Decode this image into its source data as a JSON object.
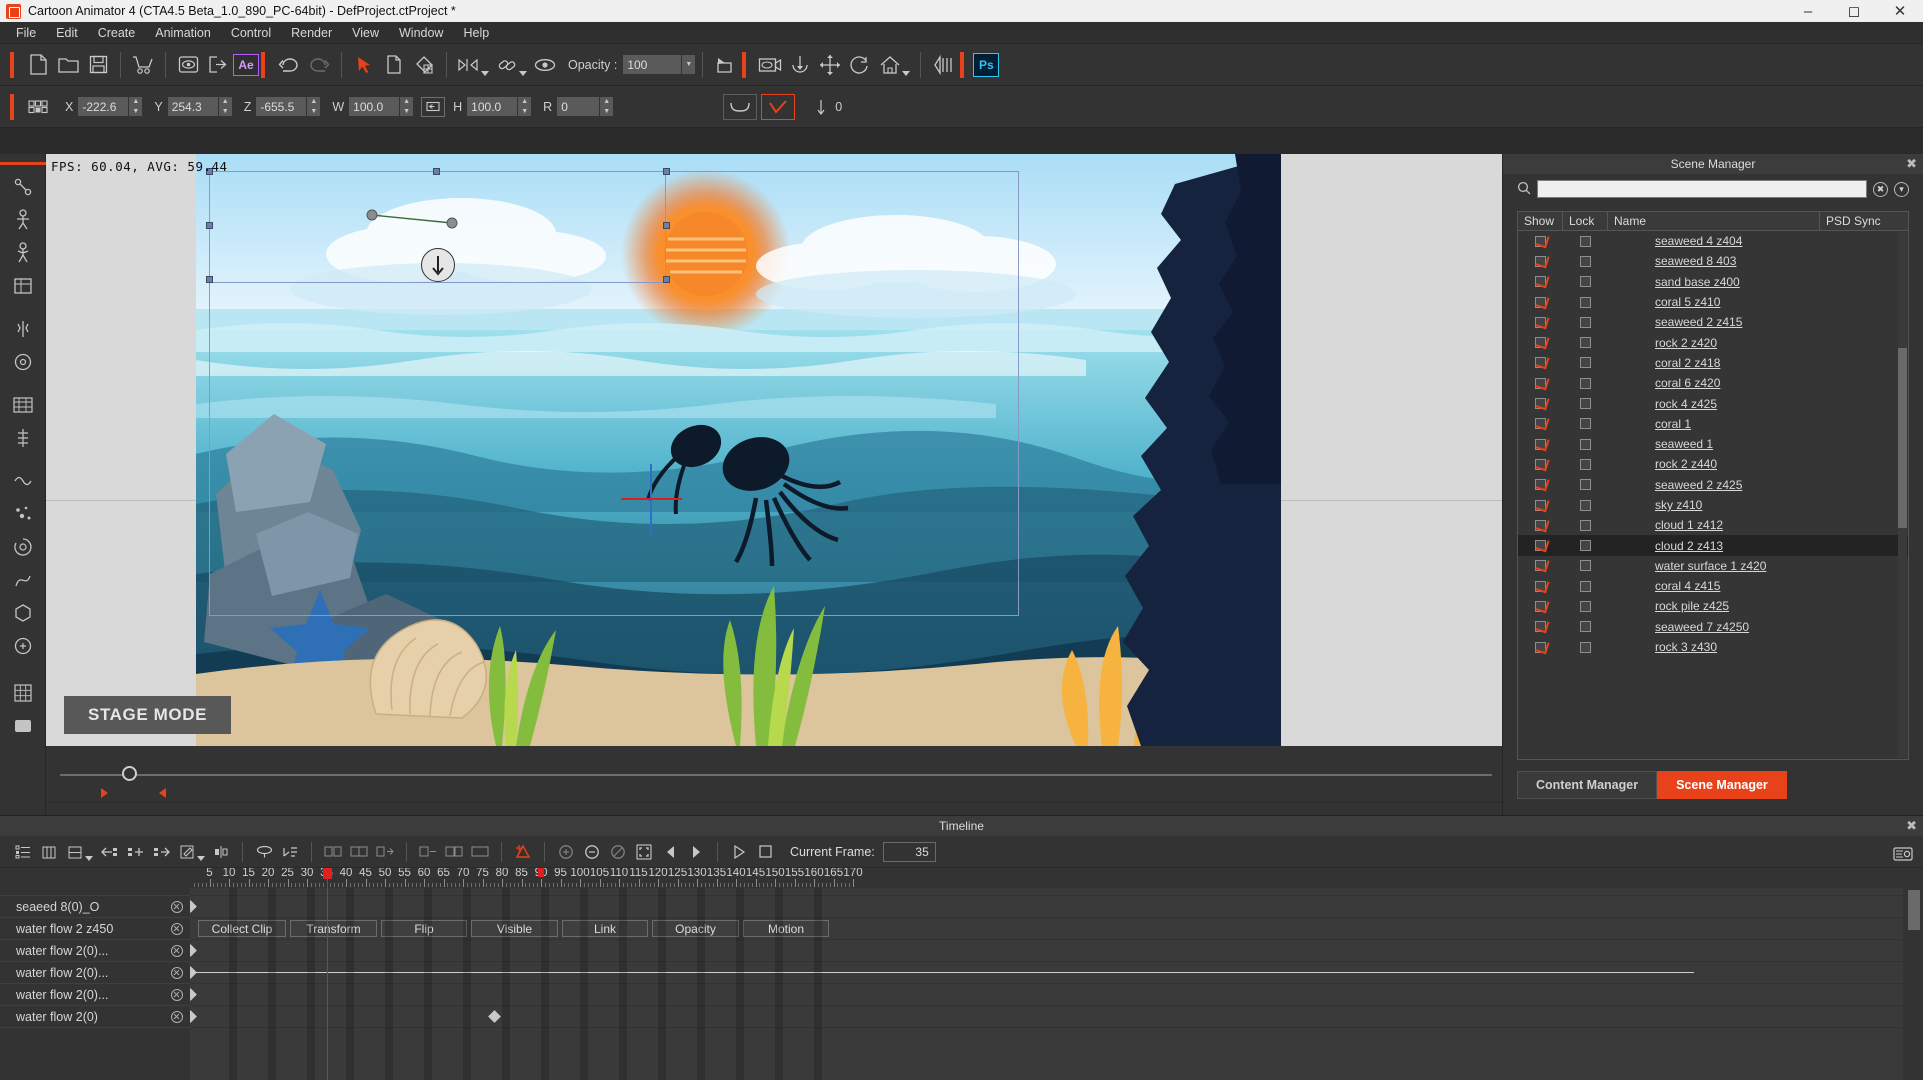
{
  "window": {
    "title": "Cartoon Animator 4  (CTA4.5 Beta_1.0_890_PC-64bit) - DefProject.ctProject *",
    "logo_icon": "cartoon-animator-logo",
    "minimize": "–",
    "maximize": "☐",
    "close": "✕"
  },
  "menu": {
    "items": [
      "File",
      "Edit",
      "Create",
      "Animation",
      "Control",
      "Render",
      "View",
      "Window",
      "Help"
    ]
  },
  "toolbar_main": {
    "icons": [
      "new-project-icon",
      "open-project-icon",
      "save-project-icon",
      "store-cart-icon",
      "preview-icon",
      "export-icon",
      "after-effects-icon",
      "undo-icon",
      "redo-icon",
      "select-arrow-icon",
      "duplicate-icon",
      "fill-color-icon",
      "align-icon",
      "link-icon",
      "eye-visible-icon",
      "flip-icon",
      "camera-icon",
      "pivot-icon",
      "move-icon",
      "rotate-icon",
      "home-view-icon",
      "onion-skin-icon",
      "photoshop-icon"
    ],
    "opacity_label": "Opacity :",
    "opacity_value": "100",
    "ae_badge": "Ae",
    "ps_badge": "Ps"
  },
  "transform_bar": {
    "grid_icon": "transform-pivot-grid-icon",
    "fields": [
      {
        "axis": "X",
        "value": "-222.6"
      },
      {
        "axis": "Y",
        "value": "254.3"
      },
      {
        "axis": "Z",
        "value": "-655.5"
      },
      {
        "axis": "W",
        "value": "100.0"
      },
      {
        "axis": "H",
        "value": "100.0"
      },
      {
        "axis": "R",
        "value": "0"
      }
    ],
    "lock_aspect_icon": "lock-aspect-ratio-icon",
    "smooth_icon": "curve-smooth-icon",
    "check_icon": "check-mark-icon",
    "z_label": "0",
    "z_icon": "z-depth-icon"
  },
  "left_tools": {
    "icons": [
      "bone-editor-icon",
      "character-icon",
      "puppet-icon",
      "sprite-editor-icon",
      "face-icon",
      "head-icon",
      "motion-icon",
      "spring-icon",
      "elastic-icon",
      "particle-icon",
      "camera-tool-icon",
      "path-icon",
      "prop-icon",
      "sfx-icon",
      "grid-tool-icon",
      "render-tool-icon"
    ]
  },
  "viewport": {
    "fps_text": "FPS: 60.04, AVG: 59.44",
    "stage_mode": "STAGE MODE",
    "scene": {
      "sun": "sun-graphic",
      "sky": "sky-gradient",
      "water": "underwater-scene",
      "colors": {
        "sky_top": "#9ed6f5",
        "sky_bottom": "#d9eefb",
        "water_top": "#8fd8e8",
        "water_mid": "#3fa0bd",
        "water_deep": "#1d5f7d",
        "sun": "#f57c20",
        "sand": "#e0c6a0",
        "rock_cliff": "#16233f"
      }
    }
  },
  "time_slider": {
    "position_percent": 2,
    "marker_left_icon": "range-start-marker",
    "marker_right_icon": "range-end-marker"
  },
  "transport": {
    "left_slider_icon": "speech-bubble-icon",
    "buttons": [
      "play-icon",
      "stop-icon",
      "first-frame-icon",
      "prev-frame-icon",
      "next-frame-icon",
      "last-frame-icon",
      "loop-icon"
    ],
    "frame_value": "35",
    "settings_icon": "render-settings-icon",
    "list_icon": "frame-list-icon",
    "note_icon": "music-note-icon"
  },
  "scene_manager": {
    "title": "Scene Manager",
    "close_icon": "close-icon",
    "search_icon": "search-icon",
    "clear_icon": "clear-search-icon",
    "filter_icon": "filter-dropdown-icon",
    "search_value": "",
    "columns": [
      "Show",
      "Lock",
      "Name",
      "PSD Sync"
    ],
    "rows": [
      {
        "show": true,
        "lock": false,
        "name": "seaweed 4 z404",
        "selected": false
      },
      {
        "show": true,
        "lock": false,
        "name": "seaweed 8 403",
        "selected": false
      },
      {
        "show": true,
        "lock": false,
        "name": "sand base z400",
        "selected": false
      },
      {
        "show": true,
        "lock": false,
        "name": "coral 5 z410",
        "selected": false
      },
      {
        "show": true,
        "lock": false,
        "name": "seaweed 2 z415",
        "selected": false
      },
      {
        "show": true,
        "lock": false,
        "name": "rock 2 z420",
        "selected": false
      },
      {
        "show": true,
        "lock": false,
        "name": "coral 2 z418",
        "selected": false
      },
      {
        "show": true,
        "lock": false,
        "name": "coral 6 z420",
        "selected": false
      },
      {
        "show": true,
        "lock": false,
        "name": "rock 4 z425",
        "selected": false
      },
      {
        "show": true,
        "lock": false,
        "name": "coral 1",
        "selected": false
      },
      {
        "show": true,
        "lock": false,
        "name": "seaweed 1",
        "selected": false
      },
      {
        "show": true,
        "lock": false,
        "name": "rock 2 z440",
        "selected": false
      },
      {
        "show": true,
        "lock": false,
        "name": "seaweed 2 z425",
        "selected": false
      },
      {
        "show": true,
        "lock": false,
        "name": "sky z410",
        "selected": false
      },
      {
        "show": true,
        "lock": false,
        "name": "cloud 1 z412",
        "selected": false
      },
      {
        "show": true,
        "lock": false,
        "name": "cloud 2 z413",
        "selected": true
      },
      {
        "show": true,
        "lock": false,
        "name": "water surface 1 z420",
        "selected": false
      },
      {
        "show": true,
        "lock": false,
        "name": "coral 4 z415",
        "selected": false
      },
      {
        "show": true,
        "lock": false,
        "name": "rock pile z425",
        "selected": false
      },
      {
        "show": true,
        "lock": false,
        "name": "seaweed 7 z4250",
        "selected": false
      },
      {
        "show": true,
        "lock": false,
        "name": "rock 3 z430",
        "selected": false
      }
    ],
    "tabs": [
      {
        "label": "Content Manager",
        "active": false
      },
      {
        "label": "Scene Manager",
        "active": true
      }
    ]
  },
  "timeline": {
    "title": "Timeline",
    "close_icon": "close-icon",
    "tool_icons": [
      "track-list-icon",
      "add-track-icon",
      "collapse-track-icon",
      "move-key-left-icon",
      "add-key-icon",
      "move-key-right-icon",
      "edit-key-icon",
      "mirror-key-icon",
      "spring-key-icon",
      "sort-key-icon",
      "frame-left-icon",
      "frame-all-icon",
      "frame-right-icon",
      "loop-range-icon",
      "range-start-icon",
      "range-end-icon",
      "transform-key-icon",
      "zoom-in-icon",
      "zoom-out-icon",
      "zoom-reset-icon",
      "fit-icon",
      "snap-left-icon",
      "snap-right-icon",
      "play-range-icon",
      "stop-range-icon"
    ],
    "current_frame_label": "Current Frame:",
    "current_frame_value": "35",
    "settings_icon": "timeline-settings-icon",
    "ruler_ticks": [
      5,
      10,
      15,
      20,
      25,
      30,
      35,
      40,
      45,
      50,
      55,
      60,
      65,
      70,
      75,
      80,
      85,
      90,
      95,
      100,
      105,
      110,
      115,
      120,
      125,
      130,
      135,
      140,
      145,
      150,
      155,
      160,
      165
    ],
    "playhead_frame": 35,
    "tracks": [
      {
        "name": "seaeed 8(0)_O",
        "keys": [
          0
        ]
      },
      {
        "name": "water flow 2 z450",
        "keys": [],
        "clip_buttons": [
          "Collect Clip",
          "Transform",
          "Flip",
          "Visible",
          "Link",
          "Opacity",
          "Motion"
        ]
      },
      {
        "name": "water flow 2(0)...",
        "keys": [
          0
        ]
      },
      {
        "name": "water flow 2(0)...",
        "keys": [
          0
        ],
        "line": true
      },
      {
        "name": "water flow 2(0)...",
        "keys": [
          0
        ]
      },
      {
        "name": "water flow 2(0)",
        "keys": [
          0,
          78
        ]
      }
    ]
  }
}
